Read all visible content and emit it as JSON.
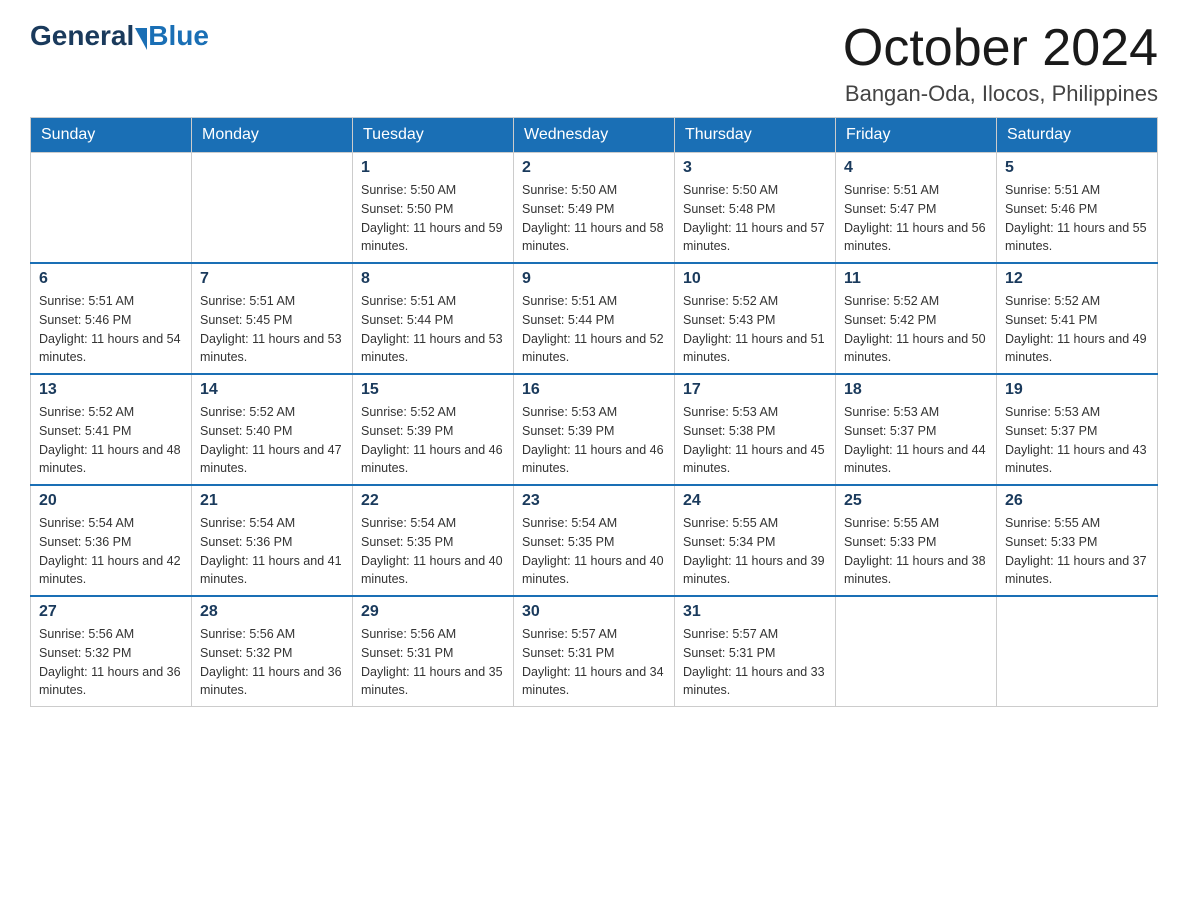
{
  "logo": {
    "general": "General",
    "arrow": "▶",
    "blue": "Blue"
  },
  "title": {
    "month": "October 2024",
    "location": "Bangan-Oda, Ilocos, Philippines"
  },
  "weekdays": [
    "Sunday",
    "Monday",
    "Tuesday",
    "Wednesday",
    "Thursday",
    "Friday",
    "Saturday"
  ],
  "weeks": [
    [
      {
        "day": "",
        "sunrise": "",
        "sunset": "",
        "daylight": ""
      },
      {
        "day": "",
        "sunrise": "",
        "sunset": "",
        "daylight": ""
      },
      {
        "day": "1",
        "sunrise": "Sunrise: 5:50 AM",
        "sunset": "Sunset: 5:50 PM",
        "daylight": "Daylight: 11 hours and 59 minutes."
      },
      {
        "day": "2",
        "sunrise": "Sunrise: 5:50 AM",
        "sunset": "Sunset: 5:49 PM",
        "daylight": "Daylight: 11 hours and 58 minutes."
      },
      {
        "day": "3",
        "sunrise": "Sunrise: 5:50 AM",
        "sunset": "Sunset: 5:48 PM",
        "daylight": "Daylight: 11 hours and 57 minutes."
      },
      {
        "day": "4",
        "sunrise": "Sunrise: 5:51 AM",
        "sunset": "Sunset: 5:47 PM",
        "daylight": "Daylight: 11 hours and 56 minutes."
      },
      {
        "day": "5",
        "sunrise": "Sunrise: 5:51 AM",
        "sunset": "Sunset: 5:46 PM",
        "daylight": "Daylight: 11 hours and 55 minutes."
      }
    ],
    [
      {
        "day": "6",
        "sunrise": "Sunrise: 5:51 AM",
        "sunset": "Sunset: 5:46 PM",
        "daylight": "Daylight: 11 hours and 54 minutes."
      },
      {
        "day": "7",
        "sunrise": "Sunrise: 5:51 AM",
        "sunset": "Sunset: 5:45 PM",
        "daylight": "Daylight: 11 hours and 53 minutes."
      },
      {
        "day": "8",
        "sunrise": "Sunrise: 5:51 AM",
        "sunset": "Sunset: 5:44 PM",
        "daylight": "Daylight: 11 hours and 53 minutes."
      },
      {
        "day": "9",
        "sunrise": "Sunrise: 5:51 AM",
        "sunset": "Sunset: 5:44 PM",
        "daylight": "Daylight: 11 hours and 52 minutes."
      },
      {
        "day": "10",
        "sunrise": "Sunrise: 5:52 AM",
        "sunset": "Sunset: 5:43 PM",
        "daylight": "Daylight: 11 hours and 51 minutes."
      },
      {
        "day": "11",
        "sunrise": "Sunrise: 5:52 AM",
        "sunset": "Sunset: 5:42 PM",
        "daylight": "Daylight: 11 hours and 50 minutes."
      },
      {
        "day": "12",
        "sunrise": "Sunrise: 5:52 AM",
        "sunset": "Sunset: 5:41 PM",
        "daylight": "Daylight: 11 hours and 49 minutes."
      }
    ],
    [
      {
        "day": "13",
        "sunrise": "Sunrise: 5:52 AM",
        "sunset": "Sunset: 5:41 PM",
        "daylight": "Daylight: 11 hours and 48 minutes."
      },
      {
        "day": "14",
        "sunrise": "Sunrise: 5:52 AM",
        "sunset": "Sunset: 5:40 PM",
        "daylight": "Daylight: 11 hours and 47 minutes."
      },
      {
        "day": "15",
        "sunrise": "Sunrise: 5:52 AM",
        "sunset": "Sunset: 5:39 PM",
        "daylight": "Daylight: 11 hours and 46 minutes."
      },
      {
        "day": "16",
        "sunrise": "Sunrise: 5:53 AM",
        "sunset": "Sunset: 5:39 PM",
        "daylight": "Daylight: 11 hours and 46 minutes."
      },
      {
        "day": "17",
        "sunrise": "Sunrise: 5:53 AM",
        "sunset": "Sunset: 5:38 PM",
        "daylight": "Daylight: 11 hours and 45 minutes."
      },
      {
        "day": "18",
        "sunrise": "Sunrise: 5:53 AM",
        "sunset": "Sunset: 5:37 PM",
        "daylight": "Daylight: 11 hours and 44 minutes."
      },
      {
        "day": "19",
        "sunrise": "Sunrise: 5:53 AM",
        "sunset": "Sunset: 5:37 PM",
        "daylight": "Daylight: 11 hours and 43 minutes."
      }
    ],
    [
      {
        "day": "20",
        "sunrise": "Sunrise: 5:54 AM",
        "sunset": "Sunset: 5:36 PM",
        "daylight": "Daylight: 11 hours and 42 minutes."
      },
      {
        "day": "21",
        "sunrise": "Sunrise: 5:54 AM",
        "sunset": "Sunset: 5:36 PM",
        "daylight": "Daylight: 11 hours and 41 minutes."
      },
      {
        "day": "22",
        "sunrise": "Sunrise: 5:54 AM",
        "sunset": "Sunset: 5:35 PM",
        "daylight": "Daylight: 11 hours and 40 minutes."
      },
      {
        "day": "23",
        "sunrise": "Sunrise: 5:54 AM",
        "sunset": "Sunset: 5:35 PM",
        "daylight": "Daylight: 11 hours and 40 minutes."
      },
      {
        "day": "24",
        "sunrise": "Sunrise: 5:55 AM",
        "sunset": "Sunset: 5:34 PM",
        "daylight": "Daylight: 11 hours and 39 minutes."
      },
      {
        "day": "25",
        "sunrise": "Sunrise: 5:55 AM",
        "sunset": "Sunset: 5:33 PM",
        "daylight": "Daylight: 11 hours and 38 minutes."
      },
      {
        "day": "26",
        "sunrise": "Sunrise: 5:55 AM",
        "sunset": "Sunset: 5:33 PM",
        "daylight": "Daylight: 11 hours and 37 minutes."
      }
    ],
    [
      {
        "day": "27",
        "sunrise": "Sunrise: 5:56 AM",
        "sunset": "Sunset: 5:32 PM",
        "daylight": "Daylight: 11 hours and 36 minutes."
      },
      {
        "day": "28",
        "sunrise": "Sunrise: 5:56 AM",
        "sunset": "Sunset: 5:32 PM",
        "daylight": "Daylight: 11 hours and 36 minutes."
      },
      {
        "day": "29",
        "sunrise": "Sunrise: 5:56 AM",
        "sunset": "Sunset: 5:31 PM",
        "daylight": "Daylight: 11 hours and 35 minutes."
      },
      {
        "day": "30",
        "sunrise": "Sunrise: 5:57 AM",
        "sunset": "Sunset: 5:31 PM",
        "daylight": "Daylight: 11 hours and 34 minutes."
      },
      {
        "day": "31",
        "sunrise": "Sunrise: 5:57 AM",
        "sunset": "Sunset: 5:31 PM",
        "daylight": "Daylight: 11 hours and 33 minutes."
      },
      {
        "day": "",
        "sunrise": "",
        "sunset": "",
        "daylight": ""
      },
      {
        "day": "",
        "sunrise": "",
        "sunset": "",
        "daylight": ""
      }
    ]
  ]
}
